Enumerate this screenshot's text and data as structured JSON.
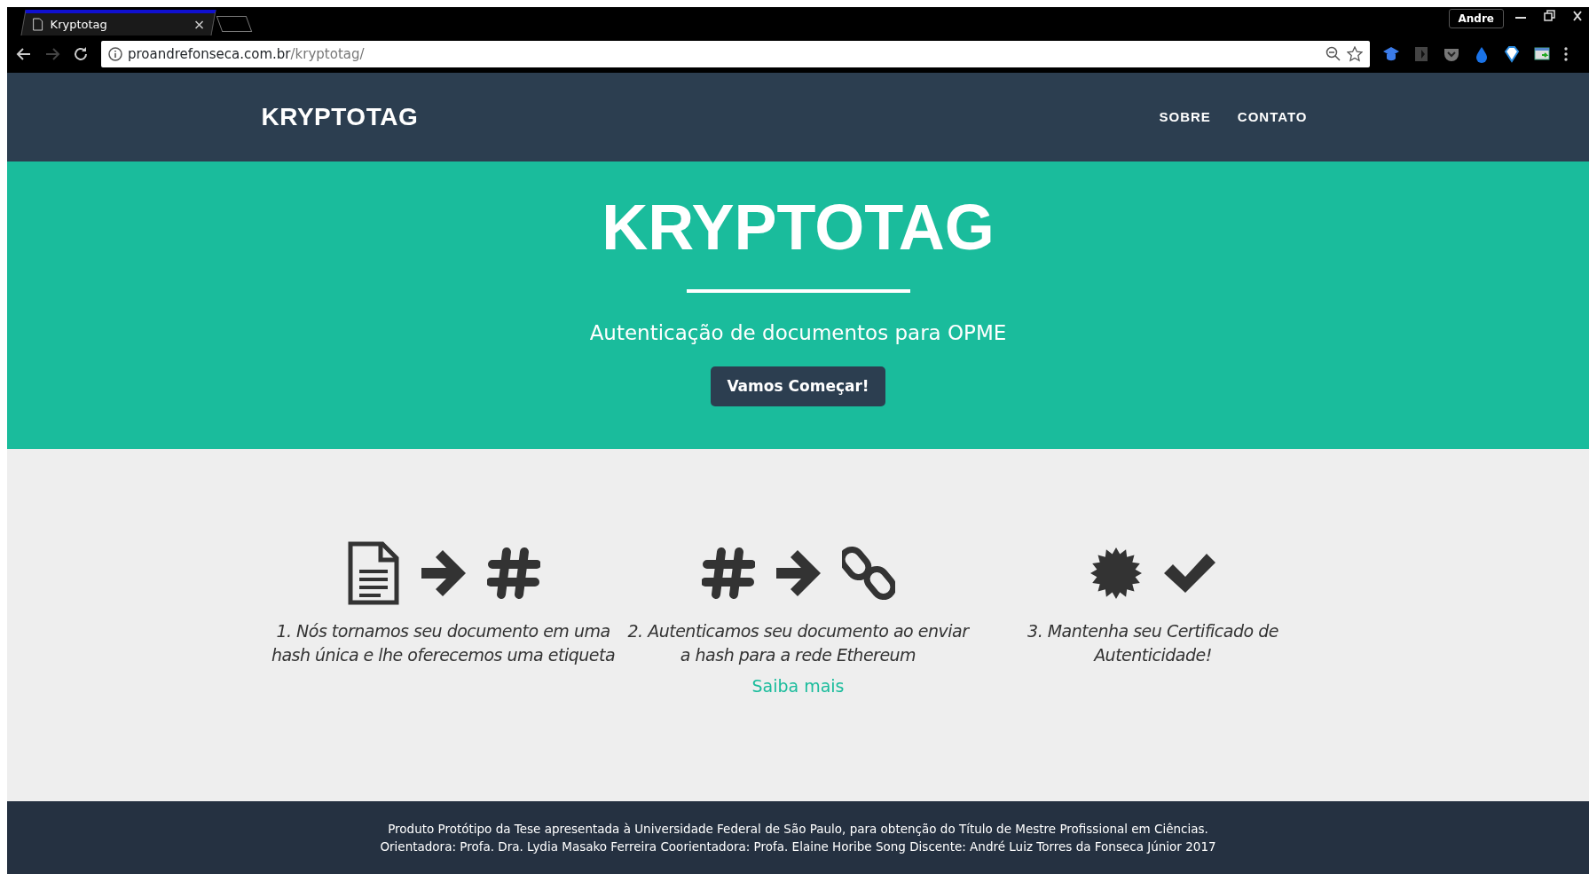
{
  "browser": {
    "tabs": [
      {
        "title": "Kryptotag",
        "selected": true
      }
    ],
    "profile": "Andre",
    "address": {
      "host": "proandrefonseca.com.br",
      "path": "/kryptotag/"
    }
  },
  "navbar": {
    "brand": "KRYPTOTAG",
    "links": [
      "SOBRE",
      "CONTATO"
    ]
  },
  "hero": {
    "title": "KRYPTOTAG",
    "subtitle": "Autenticação de documentos para OPME",
    "button": "Vamos Começar!"
  },
  "steps": [
    {
      "caption": "1. Nós tornamos seu documento em uma hash única e lhe oferecemos uma etiqueta"
    },
    {
      "caption": "2. Autenticamos seu documento ao enviar a hash para a rede Ethereum"
    },
    {
      "caption": "3. Mantenha seu Certificado de Autenticidade!"
    }
  ],
  "more_link": "Saiba mais",
  "footer": {
    "lines": [
      "Produto Protótipo da Tese apresentada à Universidade Federal de São Paulo, para obtenção do Título de Mestre Profissional em Ciências.",
      "Orientadora: Profa. Dra. Lydia Masako Ferreira Coorientadora: Profa. Elaine Horibe Song Discente: André Luiz Torres da Fonseca Júnior 2017"
    ]
  }
}
